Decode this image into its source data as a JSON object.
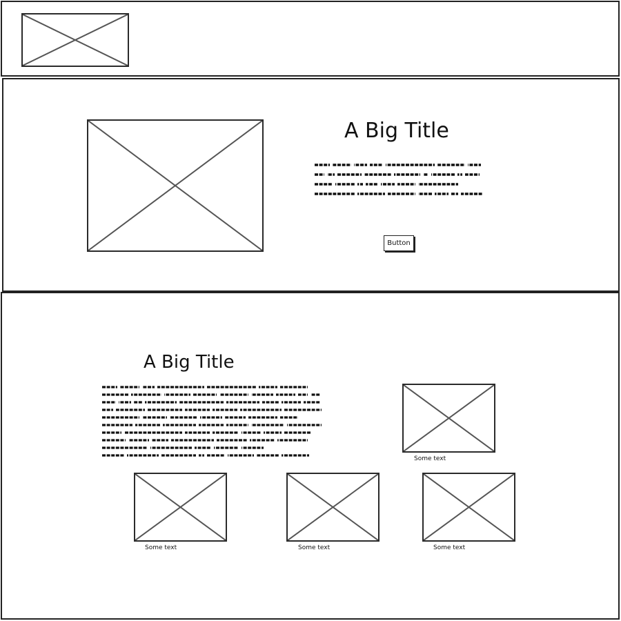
{
  "header": {
    "logo": "image-placeholder-icon"
  },
  "hero": {
    "image": "image-placeholder-icon",
    "title": "A Big Title",
    "button_label": "Button"
  },
  "content": {
    "title": "A Big Title",
    "feature_image": {
      "icon": "image-placeholder-icon",
      "caption": "Some text"
    },
    "cards": [
      {
        "icon": "image-placeholder-icon",
        "caption": "Some text"
      },
      {
        "icon": "image-placeholder-icon",
        "caption": "Some text"
      },
      {
        "icon": "image-placeholder-icon",
        "caption": "Some text"
      }
    ]
  }
}
